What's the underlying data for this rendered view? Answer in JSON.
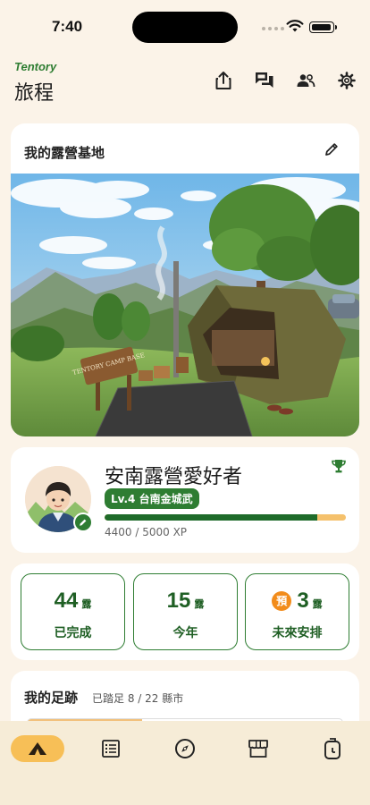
{
  "status_bar": {
    "time": "7:40"
  },
  "header": {
    "brand": "Tentory",
    "title": "旅程"
  },
  "header_icons": [
    "share-icon",
    "chat-icon",
    "friends-icon",
    "settings-icon"
  ],
  "camp_base": {
    "title": "我的露營基地",
    "sign_text": "TENTORY CAMP BASE"
  },
  "profile": {
    "name": "安南露營愛好者",
    "level": "Lv.4 台南金城武",
    "xp_text": "4400 / 5000 XP",
    "xp_current": 4400,
    "xp_max": 5000,
    "xp_fraction": 0.88
  },
  "stats": [
    {
      "value": "44",
      "unit": "露",
      "label": "已完成"
    },
    {
      "value": "15",
      "unit": "露",
      "label": "今年"
    },
    {
      "badge": "預",
      "value": "3",
      "unit": "露",
      "label": "未來安排"
    }
  ],
  "footprint": {
    "title": "我的足跡",
    "subtitle": "已踏足 8 / 22 縣市",
    "visited": 8,
    "total": 22
  },
  "tabs": [
    {
      "icon": "tent-icon",
      "active": true
    },
    {
      "icon": "list-icon",
      "active": false
    },
    {
      "icon": "compass-icon",
      "active": false
    },
    {
      "icon": "store-icon",
      "active": false
    },
    {
      "icon": "backpack-icon",
      "active": false
    }
  ],
  "colors": {
    "accent": "#2e7d32",
    "background": "#fbf3e8",
    "tab_active": "#f7bf57",
    "badge": "#f28c1b"
  }
}
